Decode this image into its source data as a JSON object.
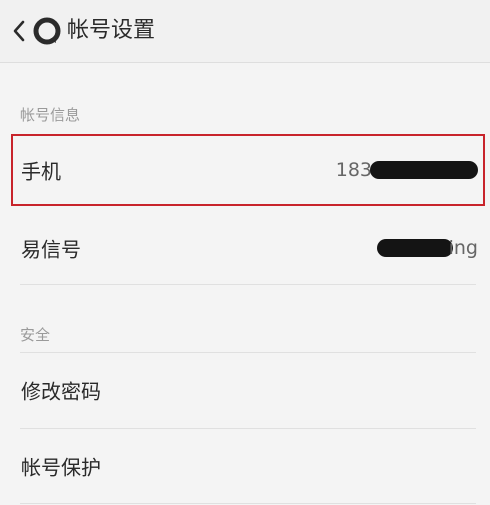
{
  "header": {
    "title": "帐号设置",
    "back_icon": "chevron-left-icon",
    "logo_icon": "app-logo-icon"
  },
  "sections": [
    {
      "label": "帐号信息",
      "items": [
        {
          "label": "手机",
          "value_visible": "183",
          "value_redacted": true
        },
        {
          "label": "易信号",
          "value_visible": "ing",
          "value_redacted": true
        }
      ]
    },
    {
      "label": "安全",
      "items": [
        {
          "label": "修改密码"
        },
        {
          "label": "帐号保护"
        }
      ]
    }
  ],
  "colors": {
    "highlight": "#c8242b",
    "redaction": "#141414"
  }
}
